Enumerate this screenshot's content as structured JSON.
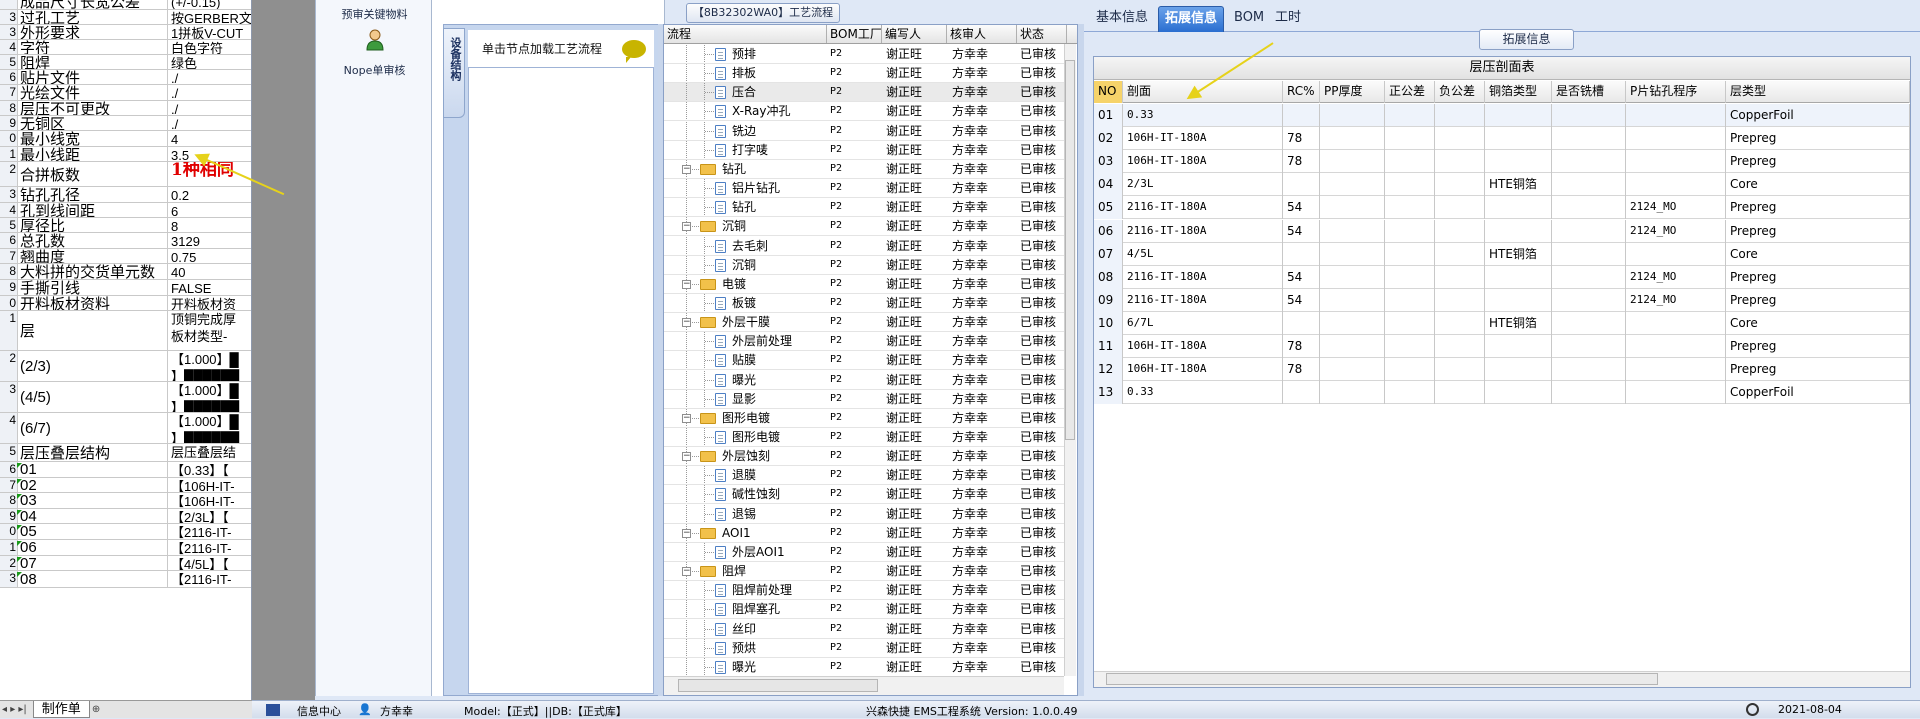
{
  "sheet": {
    "rows": [
      {
        "n": "",
        "label": "成品尺寸长宽公差",
        "value": "(+/-0.15)"
      },
      {
        "n": "3",
        "label": "过孔工艺",
        "value": "按GERBER文"
      },
      {
        "n": "3",
        "label": "外形要求",
        "value": "1拼板V-CUT"
      },
      {
        "n": "4",
        "label": "字符",
        "value": "白色字符"
      },
      {
        "n": "5",
        "label": "阻焊",
        "value": "绿色"
      },
      {
        "n": "6",
        "label": "贴片文件",
        "value": "./"
      },
      {
        "n": "7",
        "label": "光绘文件",
        "value": "./"
      },
      {
        "n": "8",
        "label": "层压不可更改",
        "value": "./"
      },
      {
        "n": "9",
        "label": "无铜区",
        "value": "./"
      },
      {
        "n": "0",
        "label": "最小线宽",
        "value": "4"
      },
      {
        "n": "1",
        "label": "最小线距",
        "value": "3.5"
      },
      {
        "n": "2",
        "label": "合拼板数",
        "value": "1种相同",
        "red": true
      },
      {
        "n": "3",
        "label": "钻孔孔径",
        "value": "0.2"
      },
      {
        "n": "4",
        "label": "孔到线间距",
        "value": "6"
      },
      {
        "n": "5",
        "label": "厚径比",
        "value": "8"
      },
      {
        "n": "6",
        "label": "总孔数",
        "value": "3129"
      },
      {
        "n": "7",
        "label": "翘曲度",
        "value": "0.75"
      },
      {
        "n": "8",
        "label": "大料拼的交货单元数",
        "value": "40"
      },
      {
        "n": "9",
        "label": "手撕引线",
        "value": "FALSE"
      },
      {
        "n": "0",
        "label": "开料板材资料",
        "value": "开料板材资"
      },
      {
        "n": "1",
        "label": "层",
        "value": "顶铜完成厚\n板材类型-"
      },
      {
        "n": "2",
        "label": "(2/3)",
        "value": "【1.000】█\n】██████"
      },
      {
        "n": "3",
        "label": "(4/5)",
        "value": "【1.000】█\n】██████"
      },
      {
        "n": "4",
        "label": "(6/7)",
        "value": "【1.000】█\n】██████"
      },
      {
        "n": "5",
        "label": "层压叠层结构",
        "value": "层压叠层结"
      },
      {
        "n": "6",
        "label": "01",
        "value": "【0.33】【"
      },
      {
        "n": "7",
        "label": "02",
        "value": "【106H-IT-"
      },
      {
        "n": "8",
        "label": "03",
        "value": "【106H-IT-"
      },
      {
        "n": "9",
        "label": "04",
        "value": "【2/3L】【"
      },
      {
        "n": "0",
        "label": "05",
        "value": "【2116-IT-"
      },
      {
        "n": "1",
        "label": "06",
        "value": "【2116-IT-"
      },
      {
        "n": "2",
        "label": "07",
        "value": "【4/5L】【"
      },
      {
        "n": "3",
        "label": "08",
        "value": "【2116-IT-"
      }
    ],
    "tab_label": "制作单"
  },
  "panel1": {
    "item1": "预审关键物料",
    "item2": "Nope单审核"
  },
  "panel2": {
    "vtab": "设备结构",
    "load_label": "单击节点加载工艺流程"
  },
  "flow": {
    "title": "【8B32302WA0】工艺流程",
    "headers": [
      "流程",
      "BOM工厂",
      "编写人",
      "核审人",
      "状态"
    ],
    "rows": [
      {
        "lvl": 2,
        "type": "doc",
        "name": "预排",
        "bom": "P2",
        "writer": "谢正旺",
        "reviewer": "方幸幸",
        "status": "已审核"
      },
      {
        "lvl": 2,
        "type": "doc",
        "name": "排板",
        "bom": "P2",
        "writer": "谢正旺",
        "reviewer": "方幸幸",
        "status": "已审核"
      },
      {
        "lvl": 2,
        "type": "doc",
        "name": "压合",
        "bom": "P2",
        "writer": "谢正旺",
        "reviewer": "方幸幸",
        "status": "已审核",
        "sel": true
      },
      {
        "lvl": 2,
        "type": "doc",
        "name": "X-Ray冲孔",
        "bom": "P2",
        "writer": "谢正旺",
        "reviewer": "方幸幸",
        "status": "已审核"
      },
      {
        "lvl": 2,
        "type": "doc",
        "name": "铣边",
        "bom": "P2",
        "writer": "谢正旺",
        "reviewer": "方幸幸",
        "status": "已审核"
      },
      {
        "lvl": 2,
        "type": "doc",
        "name": "打字唛",
        "bom": "P2",
        "writer": "谢正旺",
        "reviewer": "方幸幸",
        "status": "已审核"
      },
      {
        "lvl": 1,
        "type": "folder",
        "name": "钻孔",
        "bom": "P2",
        "writer": "谢正旺",
        "reviewer": "方幸幸",
        "status": "已审核"
      },
      {
        "lvl": 2,
        "type": "doc",
        "name": "铝片钻孔",
        "bom": "P2",
        "writer": "谢正旺",
        "reviewer": "方幸幸",
        "status": "已审核"
      },
      {
        "lvl": 2,
        "type": "doc",
        "name": "钻孔",
        "bom": "P2",
        "writer": "谢正旺",
        "reviewer": "方幸幸",
        "status": "已审核"
      },
      {
        "lvl": 1,
        "type": "folder",
        "name": "沉铜",
        "bom": "P2",
        "writer": "谢正旺",
        "reviewer": "方幸幸",
        "status": "已审核"
      },
      {
        "lvl": 2,
        "type": "doc",
        "name": "去毛刺",
        "bom": "P2",
        "writer": "谢正旺",
        "reviewer": "方幸幸",
        "status": "已审核"
      },
      {
        "lvl": 2,
        "type": "doc",
        "name": "沉铜",
        "bom": "P2",
        "writer": "谢正旺",
        "reviewer": "方幸幸",
        "status": "已审核"
      },
      {
        "lvl": 1,
        "type": "folder",
        "name": "电镀",
        "bom": "P2",
        "writer": "谢正旺",
        "reviewer": "方幸幸",
        "status": "已审核"
      },
      {
        "lvl": 2,
        "type": "doc",
        "name": "板镀",
        "bom": "P2",
        "writer": "谢正旺",
        "reviewer": "方幸幸",
        "status": "已审核"
      },
      {
        "lvl": 1,
        "type": "folder",
        "name": "外层干膜",
        "bom": "P2",
        "writer": "谢正旺",
        "reviewer": "方幸幸",
        "status": "已审核"
      },
      {
        "lvl": 2,
        "type": "doc",
        "name": "外层前处理",
        "bom": "P2",
        "writer": "谢正旺",
        "reviewer": "方幸幸",
        "status": "已审核"
      },
      {
        "lvl": 2,
        "type": "doc",
        "name": "贴膜",
        "bom": "P2",
        "writer": "谢正旺",
        "reviewer": "方幸幸",
        "status": "已审核"
      },
      {
        "lvl": 2,
        "type": "doc",
        "name": "曝光",
        "bom": "P2",
        "writer": "谢正旺",
        "reviewer": "方幸幸",
        "status": "已审核"
      },
      {
        "lvl": 2,
        "type": "doc",
        "name": "显影",
        "bom": "P2",
        "writer": "谢正旺",
        "reviewer": "方幸幸",
        "status": "已审核"
      },
      {
        "lvl": 1,
        "type": "folder",
        "name": "图形电镀",
        "bom": "P2",
        "writer": "谢正旺",
        "reviewer": "方幸幸",
        "status": "已审核"
      },
      {
        "lvl": 2,
        "type": "doc",
        "name": "图形电镀",
        "bom": "P2",
        "writer": "谢正旺",
        "reviewer": "方幸幸",
        "status": "已审核"
      },
      {
        "lvl": 1,
        "type": "folder",
        "name": "外层蚀刻",
        "bom": "P2",
        "writer": "谢正旺",
        "reviewer": "方幸幸",
        "status": "已审核"
      },
      {
        "lvl": 2,
        "type": "doc",
        "name": "退膜",
        "bom": "P2",
        "writer": "谢正旺",
        "reviewer": "方幸幸",
        "status": "已审核"
      },
      {
        "lvl": 2,
        "type": "doc",
        "name": "碱性蚀刻",
        "bom": "P2",
        "writer": "谢正旺",
        "reviewer": "方幸幸",
        "status": "已审核"
      },
      {
        "lvl": 2,
        "type": "doc",
        "name": "退锡",
        "bom": "P2",
        "writer": "谢正旺",
        "reviewer": "方幸幸",
        "status": "已审核"
      },
      {
        "lvl": 1,
        "type": "folder",
        "name": "AOI1",
        "bom": "P2",
        "writer": "谢正旺",
        "reviewer": "方幸幸",
        "status": "已审核"
      },
      {
        "lvl": 2,
        "type": "doc",
        "name": "外层AOI1",
        "bom": "P2",
        "writer": "谢正旺",
        "reviewer": "方幸幸",
        "status": "已审核"
      },
      {
        "lvl": 1,
        "type": "folder",
        "name": "阻焊",
        "bom": "P2",
        "writer": "谢正旺",
        "reviewer": "方幸幸",
        "status": "已审核"
      },
      {
        "lvl": 2,
        "type": "doc",
        "name": "阻焊前处理",
        "bom": "P2",
        "writer": "谢正旺",
        "reviewer": "方幸幸",
        "status": "已审核"
      },
      {
        "lvl": 2,
        "type": "doc",
        "name": "阻焊塞孔",
        "bom": "P2",
        "writer": "谢正旺",
        "reviewer": "方幸幸",
        "status": "已审核"
      },
      {
        "lvl": 2,
        "type": "doc",
        "name": "丝印",
        "bom": "P2",
        "writer": "谢正旺",
        "reviewer": "方幸幸",
        "status": "已审核"
      },
      {
        "lvl": 2,
        "type": "doc",
        "name": "预烘",
        "bom": "P2",
        "writer": "谢正旺",
        "reviewer": "方幸幸",
        "status": "已审核"
      },
      {
        "lvl": 2,
        "type": "doc",
        "name": "曝光",
        "bom": "P2",
        "writer": "谢正旺",
        "reviewer": "方幸幸",
        "status": "已审核"
      }
    ]
  },
  "right": {
    "tabs": [
      "基本信息",
      "拓展信息",
      "BOM",
      "工时"
    ],
    "active_tab": 1,
    "section_title": "拓展信息",
    "table_title": "层压剖面表",
    "headers": [
      "NO",
      "剖面",
      "RC%",
      "PP厚度",
      "正公差",
      "负公差",
      "铜箔类型",
      "是否铣槽",
      "P片钻孔程序",
      "层类型"
    ],
    "rows": [
      [
        "01",
        "0.33",
        "",
        "",
        "",
        "",
        "",
        "",
        "",
        "CopperFoil"
      ],
      [
        "02",
        "106H-IT-180A",
        "78",
        "",
        "",
        "",
        "",
        "",
        "",
        "Prepreg"
      ],
      [
        "03",
        "106H-IT-180A",
        "78",
        "",
        "",
        "",
        "",
        "",
        "",
        "Prepreg"
      ],
      [
        "04",
        "2/3L",
        "",
        "",
        "",
        "",
        "HTE铜箔",
        "",
        "",
        "Core"
      ],
      [
        "05",
        "2116-IT-180A",
        "54",
        "",
        "",
        "",
        "",
        "",
        "2124_MO",
        "Prepreg"
      ],
      [
        "06",
        "2116-IT-180A",
        "54",
        "",
        "",
        "",
        "",
        "",
        "2124_MO",
        "Prepreg"
      ],
      [
        "07",
        "4/5L",
        "",
        "",
        "",
        "",
        "HTE铜箔",
        "",
        "",
        "Core"
      ],
      [
        "08",
        "2116-IT-180A",
        "54",
        "",
        "",
        "",
        "",
        "",
        "2124_MO",
        "Prepreg"
      ],
      [
        "09",
        "2116-IT-180A",
        "54",
        "",
        "",
        "",
        "",
        "",
        "2124_MO",
        "Prepreg"
      ],
      [
        "10",
        "6/7L",
        "",
        "",
        "",
        "",
        "HTE铜箔",
        "",
        "",
        "Core"
      ],
      [
        "11",
        "106H-IT-180A",
        "78",
        "",
        "",
        "",
        "",
        "",
        "",
        "Prepreg"
      ],
      [
        "12",
        "106H-IT-180A",
        "78",
        "",
        "",
        "",
        "",
        "",
        "",
        "Prepreg"
      ],
      [
        "13",
        "0.33",
        "",
        "",
        "",
        "",
        "",
        "",
        "",
        "CopperFoil"
      ]
    ]
  },
  "status": {
    "info_center": "信息中心",
    "user": "方幸幸",
    "model": "Model:【正式】||DB:【正式库】",
    "system": "兴森快捷 EMS工程系统 Version: 1.0.0.49",
    "date": "2021-08-04"
  },
  "colors": {
    "accent": "#2a6ed0",
    "arrow": "#e6d21a",
    "highlight": "#f6d36a",
    "red_text": "#e00000"
  }
}
